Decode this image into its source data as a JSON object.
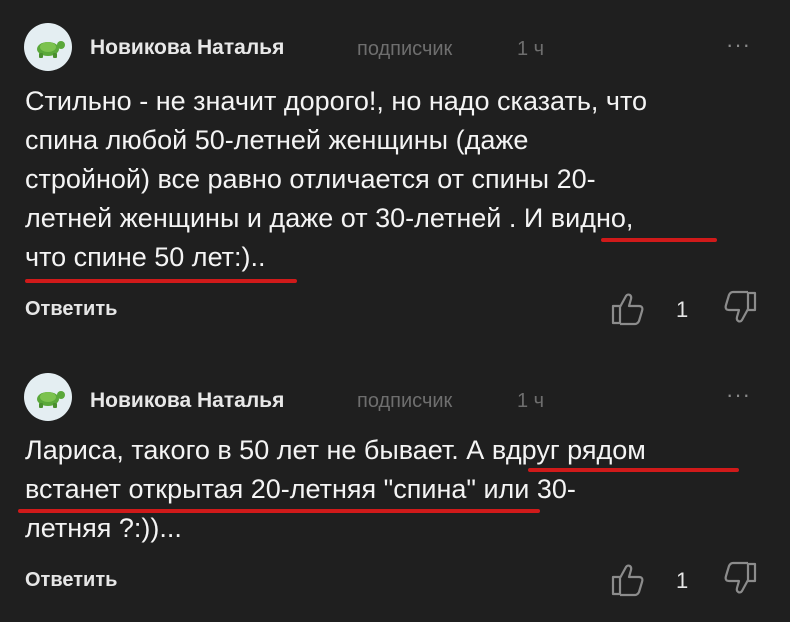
{
  "comments": [
    {
      "author": "Новикова Наталья",
      "role": "подписчик",
      "time": "1 ч",
      "more": "···",
      "lines": [
        "Стильно - не значит дорого!, но надо сказать, что",
        "спина любой 50-летней женщины (даже",
        "стройной) все равно отличается от спины 20-",
        "летней женщины и даже от 30-летней . И видно,",
        "что спине 50 лет:).."
      ],
      "reply_label": "Ответить",
      "likes": "1"
    },
    {
      "author": "Новикова Наталья",
      "role": "подписчик",
      "time": "1 ч",
      "more": "···",
      "lines": [
        "Лариса, такого в 50 лет не бывает. А вдруг рядом",
        "встанет  открытая 20-летняя \"спина\"  или 30-",
        "летняя ?:))..."
      ],
      "reply_label": "Ответить",
      "likes": "1"
    }
  ],
  "icons": {
    "avatar": "turtle-avatar-icon",
    "like": "thumbs-up-icon",
    "dislike": "thumbs-down-icon",
    "more": "more-dots-icon"
  },
  "colors": {
    "background": "#1f1f1f",
    "text": "#f4f4f4",
    "muted": "#6e6e6e",
    "annotation": "#d01a1a"
  }
}
